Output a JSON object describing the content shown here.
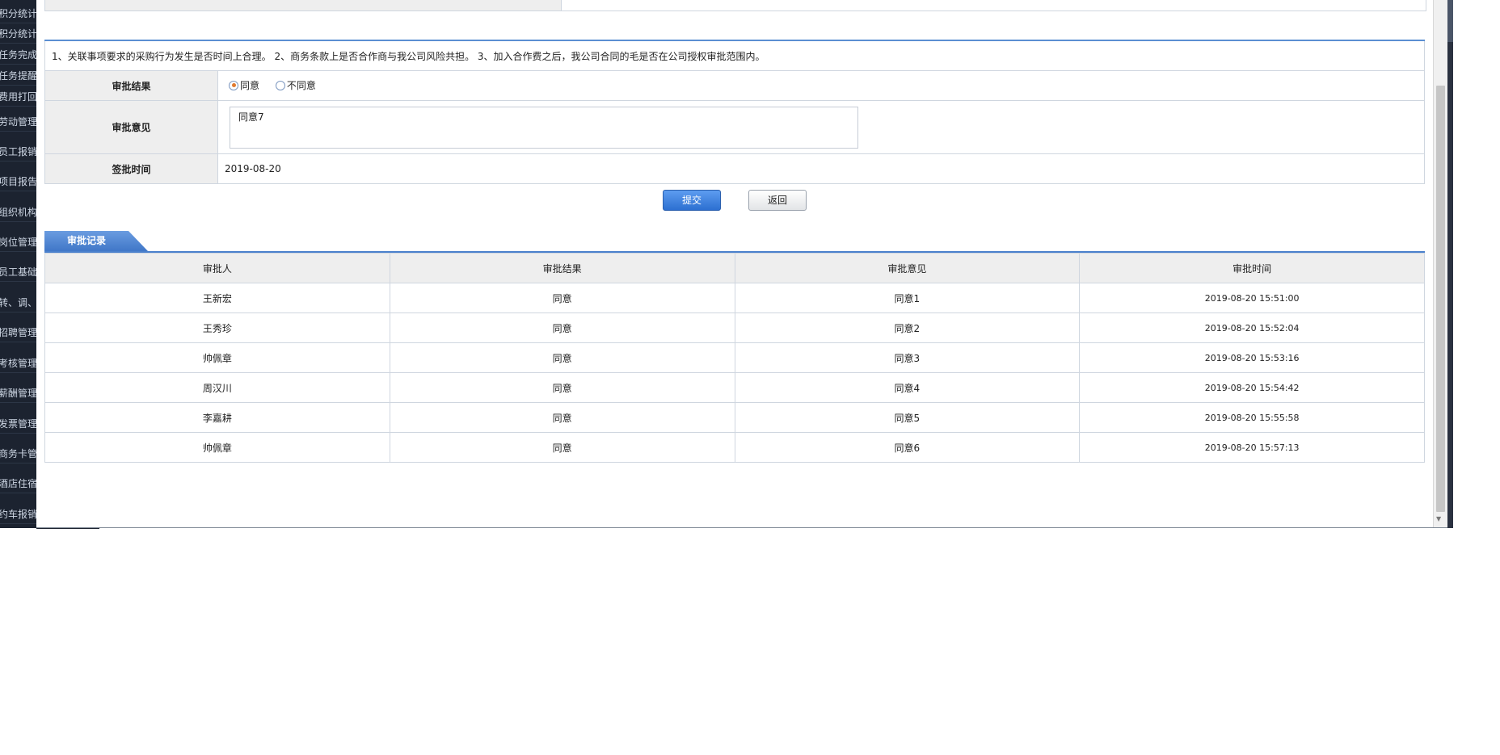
{
  "sidebar": {
    "items": [
      "积分统计",
      "积分统计",
      "任务完成",
      "任务提醒",
      "费用打回",
      "劳动管理",
      "员工报销",
      "项目报告中",
      "组织机构管",
      "岗位管理",
      "员工基础信",
      "转、调、离",
      "招聘管理",
      "考核管理",
      "薪酬管理",
      "发票管理",
      "商务卡管理",
      "酒店住宿管",
      "约车报销"
    ]
  },
  "notice": "1、关联事项要求的采购行为发生是否时间上合理。 2、商务条款上是否合作商与我公司风险共担。 3、加入合作费之后，我公司合同的毛是否在公司授权审批范围内。",
  "form": {
    "result_label": "审批结果",
    "options": {
      "agree": "同意",
      "disagree": "不同意"
    },
    "selected": "同意",
    "opinion_label": "审批意见",
    "opinion_value": "同意7",
    "time_label": "签批时间",
    "time_value": "2019-08-20"
  },
  "buttons": {
    "submit": "提交",
    "back": "返回"
  },
  "records": {
    "tab_label": "审批记录",
    "headers": [
      "审批人",
      "审批结果",
      "审批意见",
      "审批时间"
    ],
    "rows": [
      [
        "王新宏",
        "同意",
        "同意1",
        "2019-08-20 15:51:00"
      ],
      [
        "王秀珍",
        "同意",
        "同意2",
        "2019-08-20 15:52:04"
      ],
      [
        "帅佩章",
        "同意",
        "同意3",
        "2019-08-20 15:53:16"
      ],
      [
        "周汉川",
        "同意",
        "同意4",
        "2019-08-20 15:54:42"
      ],
      [
        "李嘉耕",
        "同意",
        "同意5",
        "2019-08-20 15:55:58"
      ],
      [
        "帅佩章",
        "同意",
        "同意6",
        "2019-08-20 15:57:13"
      ]
    ]
  },
  "colors": {
    "accent": "#4a80cc",
    "submit": "#2c6fd1",
    "sidebar": "#1c2330"
  }
}
